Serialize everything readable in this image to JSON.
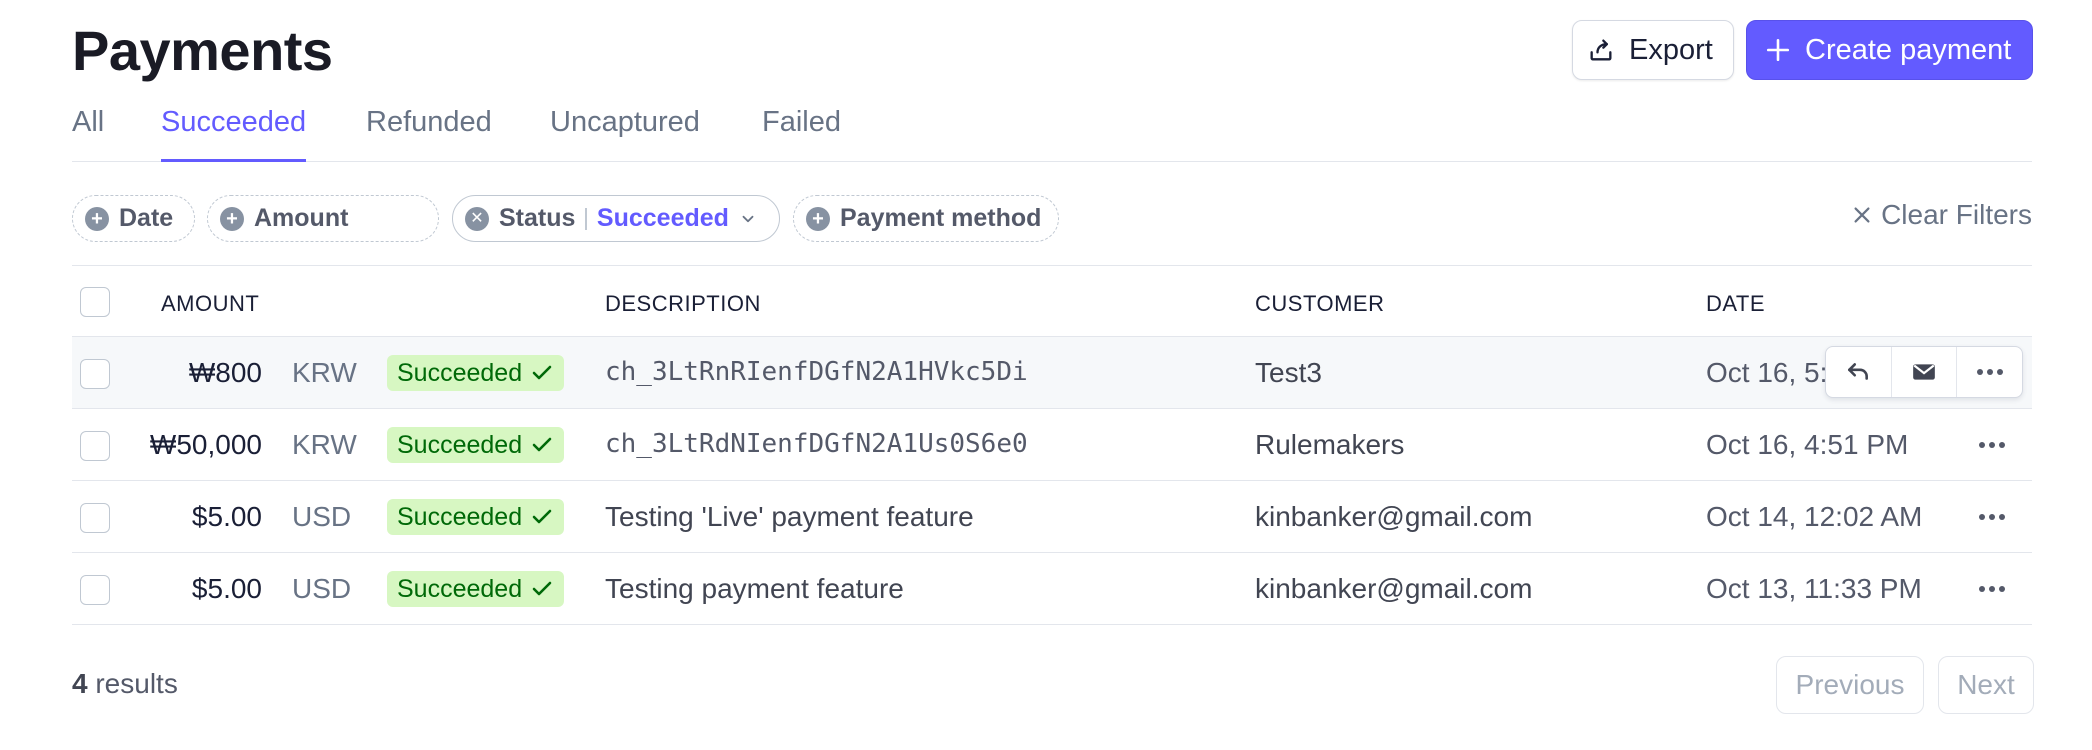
{
  "header": {
    "title": "Payments",
    "export_label": "Export",
    "create_label": "Create payment",
    "accent": "#635bff"
  },
  "tabs": [
    {
      "label": "All",
      "active": false
    },
    {
      "label": "Succeeded",
      "active": true
    },
    {
      "label": "Refunded",
      "active": false
    },
    {
      "label": "Uncaptured",
      "active": false
    },
    {
      "label": "Failed",
      "active": false
    }
  ],
  "filters": {
    "date": "Date",
    "amount": "Amount",
    "status_label": "Status",
    "status_value": "Succeeded",
    "payment_method": "Payment method",
    "clear": "Clear Filters"
  },
  "table": {
    "columns": {
      "amount": "AMOUNT",
      "description": "DESCRIPTION",
      "customer": "CUSTOMER",
      "date": "DATE"
    },
    "rows": [
      {
        "amount": "₩800",
        "currency": "KRW",
        "status": "Succeeded",
        "description": "ch_3LtRnRIenfDGfN2A1HVkc5Di",
        "customer": "Test3",
        "date": "Oct 16, 5:",
        "hovered": true
      },
      {
        "amount": "₩50,000",
        "currency": "KRW",
        "status": "Succeeded",
        "description": "ch_3LtRdNIenfDGfN2A1Us0S6e0",
        "customer": "Rulemakers",
        "date": "Oct 16, 4:51 PM",
        "hovered": false
      },
      {
        "amount": "$5.00",
        "currency": "USD",
        "status": "Succeeded",
        "description": "Testing 'Live' payment feature",
        "customer": "kinbanker@gmail.com",
        "date": "Oct 14, 12:02 AM",
        "hovered": false
      },
      {
        "amount": "$5.00",
        "currency": "USD",
        "status": "Succeeded",
        "description": "Testing payment feature",
        "customer": "kinbanker@gmail.com",
        "date": "Oct 13, 11:33 PM",
        "hovered": false
      }
    ]
  },
  "footer": {
    "results_count": "4",
    "results_label": "results",
    "previous": "Previous",
    "next": "Next"
  },
  "colors": {
    "success_bg": "#d7f7c2",
    "success_text": "#006908"
  }
}
